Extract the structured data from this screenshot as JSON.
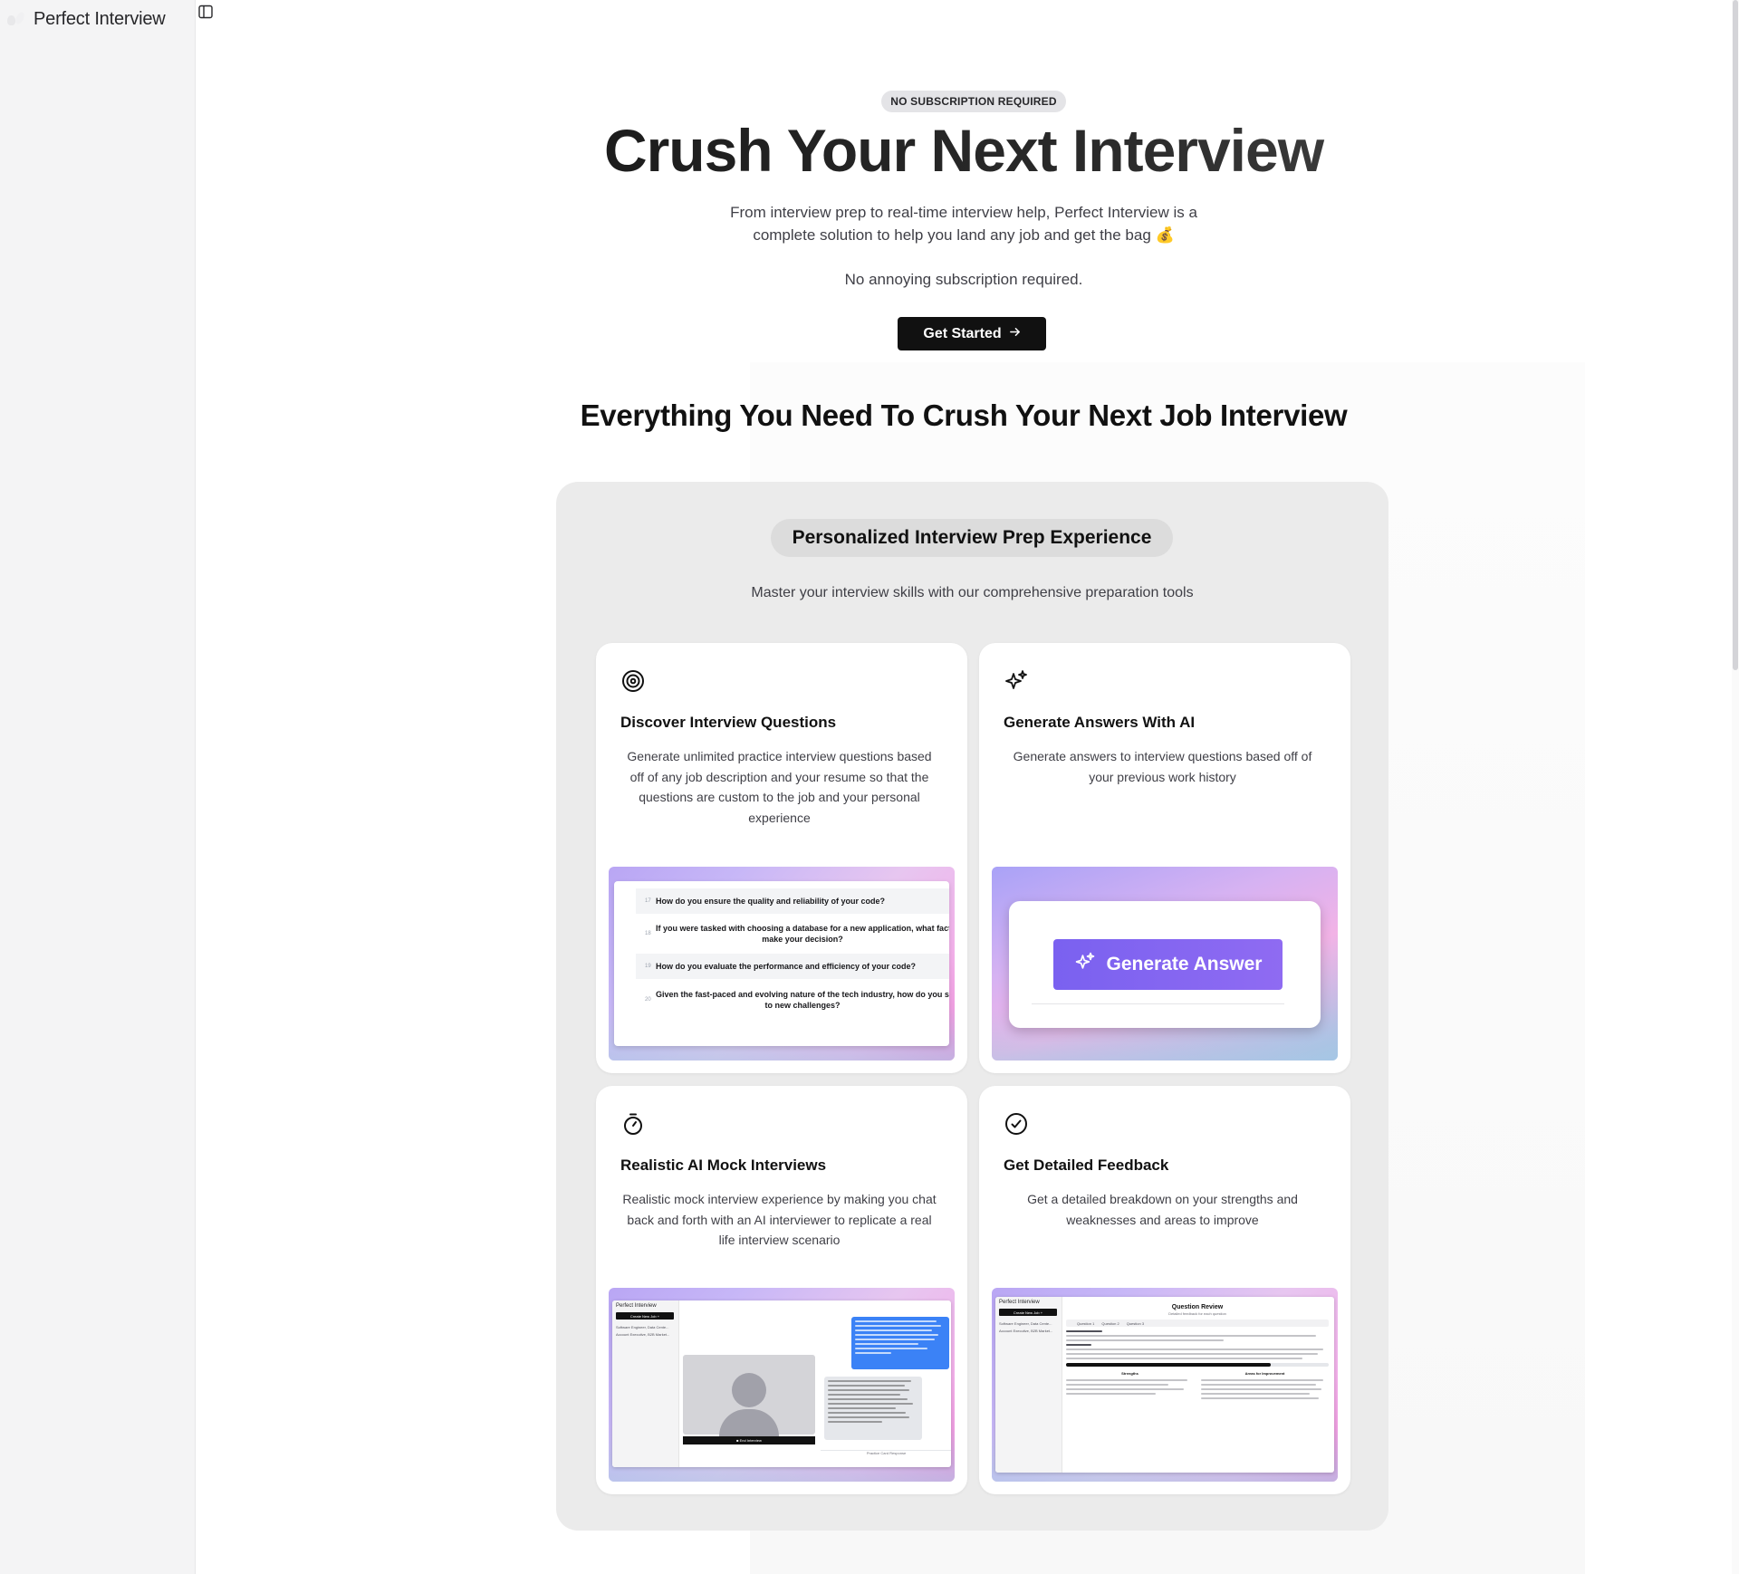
{
  "app": {
    "name": "Perfect Interview"
  },
  "hero": {
    "badge": "NO SUBSCRIPTION REQUIRED",
    "title": "Crush Your Next Interview",
    "subtitle_line1": "From interview prep to real-time interview help, Perfect Interview is a",
    "subtitle_line2": "complete solution to help you land any job and get the bag 💰",
    "note": "No annoying subscription required.",
    "cta_label": "Get Started",
    "cta_icon": "arrow-right-icon"
  },
  "section": {
    "title": "Everything You Need To Crush Your Next Job Interview"
  },
  "panel": {
    "pill": "Personalized Interview Prep Experience",
    "subtitle": "Master your interview skills with our comprehensive preparation tools"
  },
  "cards": [
    {
      "icon": "target-icon",
      "title": "Discover Interview Questions",
      "description": "Generate unlimited practice interview questions based off of any job description and your resume so that the questions are custom to the job and your personal experience",
      "questions": [
        {
          "num": "17",
          "text": "How do you ensure the quality and reliability of your code?"
        },
        {
          "num": "18",
          "text": "If you were tasked with choosing a database for a new application, what factors wo",
          "text2": "make your decision?"
        },
        {
          "num": "19",
          "text": "How do you evaluate the performance and efficiency of your code?"
        },
        {
          "num": "20",
          "text": "Given the fast-paced and evolving nature of the tech industry, how do you stay up-t",
          "text2": "to new challenges?"
        }
      ]
    },
    {
      "icon": "sparkles-icon",
      "title": "Generate Answers With AI",
      "description": "Generate answers to interview questions based off of your previous work history",
      "button_label": "Generate Answer"
    },
    {
      "icon": "timer-icon",
      "title": "Realistic AI Mock Interviews",
      "description": "Realistic mock interview experience by making you chat back and forth with an AI interviewer to replicate a real life interview scenario",
      "mock": {
        "brand": "Perfect Interview",
        "new_job": "Create New Job +",
        "job1": "Software Engineer, Data Cente...",
        "job2": "Account Executive, B2B Market...",
        "end_label": "■ End Interview",
        "input_hint": "Practice Card Response"
      }
    },
    {
      "icon": "check-circle-icon",
      "title": "Get Detailed Feedback",
      "description": "Get a detailed breakdown on your strengths and weaknesses and areas to improve",
      "mock": {
        "brand": "Perfect Interview",
        "new_job": "Create New Job +",
        "job1": "Software Engineer, Data Cente...",
        "job2": "Account Executive, B2B Market...",
        "title": "Question Review",
        "subtitle": "Detailed feedback for each question",
        "tab1": "Question 1",
        "tab2": "Question 2",
        "tab3": "Question 3",
        "strengths": "Strengths",
        "improvements": "Areas for Improvement"
      }
    }
  ]
}
